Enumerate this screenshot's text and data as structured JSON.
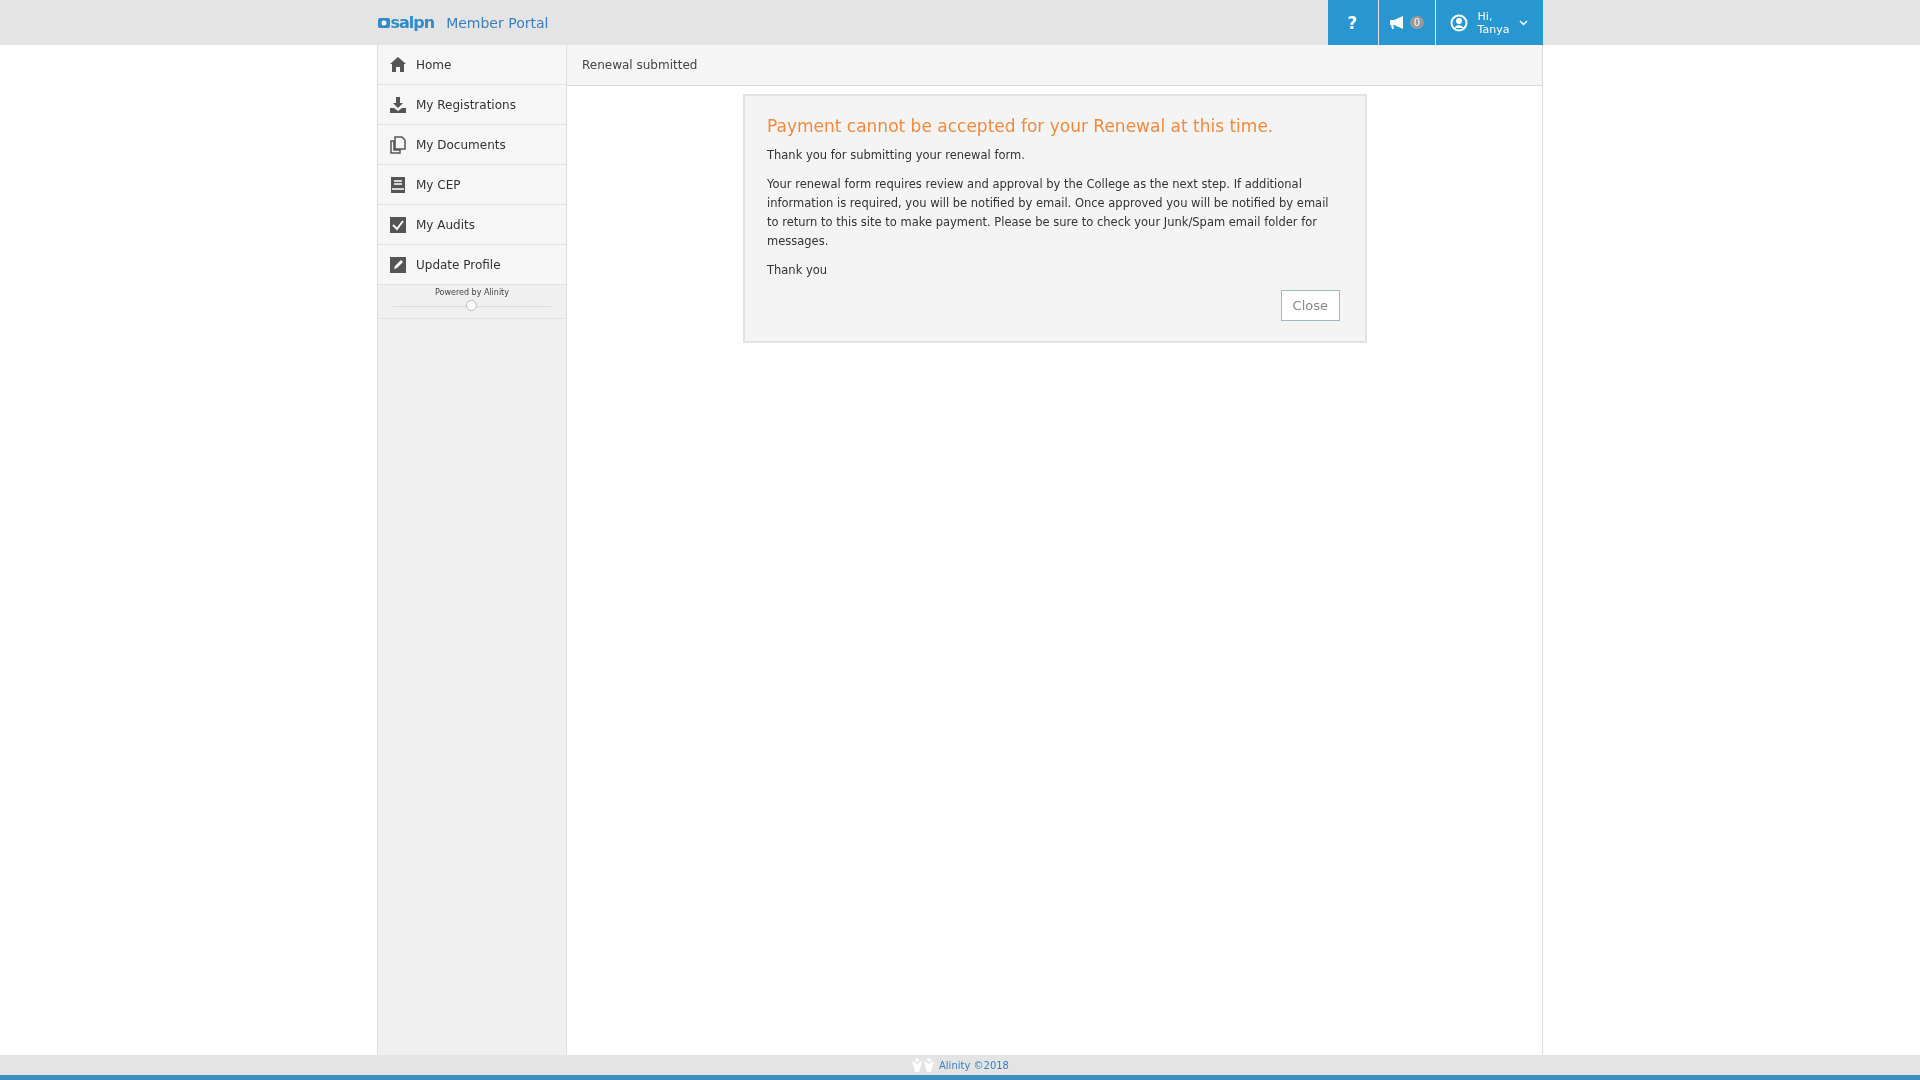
{
  "header": {
    "logo": "salpn",
    "title": "Member Portal",
    "help": "?",
    "notifications": {
      "count": "0"
    },
    "user": {
      "greeting": "Hi,",
      "name": "Tanya"
    }
  },
  "sidebar": {
    "items": [
      {
        "label": "Home",
        "kind": "home"
      },
      {
        "label": "My Registrations",
        "kind": "download"
      },
      {
        "label": "My Documents",
        "kind": "documents"
      },
      {
        "label": "My CEP",
        "kind": "book"
      },
      {
        "label": "My Audits",
        "kind": "check"
      },
      {
        "label": "Update Profile",
        "kind": "edit"
      }
    ],
    "powered_by": "Powered by Alinity",
    "slider": {
      "level": 0.5
    }
  },
  "page_title": "Renewal submitted",
  "dialog": {
    "title": "Payment cannot be accepted for your Renewal at this time.",
    "paragraphs": [
      "Thank you for submitting your renewal form.",
      "Your renewal form requires review and approval by the College as the next step. If additional information is required, you will be notified by email. Once approved you will be notified by email to return to this site to make payment. Please be sure to check your Junk/Spam email folder for messages.",
      "Thank you"
    ],
    "button": "Close"
  },
  "footer": "Alinity ©2018"
}
